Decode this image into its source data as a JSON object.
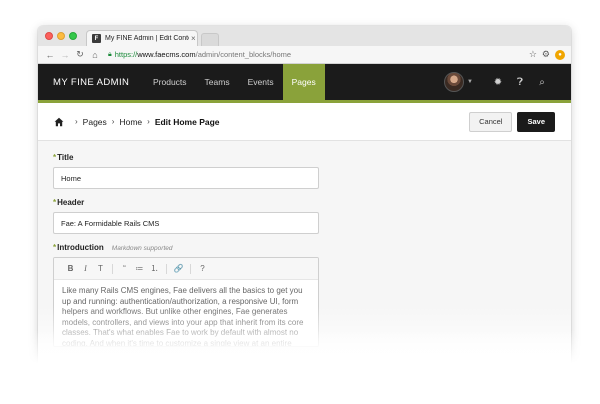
{
  "browser": {
    "tab_title": "My FINE Admin | Edit Content",
    "tab_close": "×",
    "favicon_letter": "F",
    "url_scheme": "https://",
    "url_host": "www.faecms.com",
    "url_path": "/admin/content_blocks/home",
    "icons": [
      "back-icon",
      "forward-icon",
      "reload-icon",
      "home-icon",
      "lock-icon",
      "star-icon",
      "gear-icon",
      "extension-icon"
    ]
  },
  "header": {
    "brand": "MY FINE ADMIN",
    "nav": [
      {
        "label": "Products"
      },
      {
        "label": "Teams"
      },
      {
        "label": "Events"
      },
      {
        "label": "Pages",
        "active": true
      }
    ],
    "accent_color": "#8aa23a"
  },
  "breadcrumb": {
    "items": [
      "Pages",
      "Home"
    ],
    "current": "Edit Home Page",
    "cancel_label": "Cancel",
    "save_label": "Save"
  },
  "form": {
    "title_label": "Title",
    "title_value": "Home",
    "header_label": "Header",
    "header_value": "Fae: A Formidable Rails CMS",
    "intro_label": "Introduction",
    "intro_hint": "Markdown supported",
    "toolbar": [
      "B",
      "I",
      "T",
      "“",
      "≔",
      "⒈",
      "🔗",
      "?"
    ],
    "intro_text": "Like many Rails CMS engines, Fae delivers all the basics to get you up and running: authentication/authorization, a responsive UI, form helpers and workflows. But unlike other engines, Fae generates models, controllers, and views into your app that inherit from its core classes. That's what enables Fae to work by default with almost no coding. And when it's time to customize a single view at an entire"
  }
}
